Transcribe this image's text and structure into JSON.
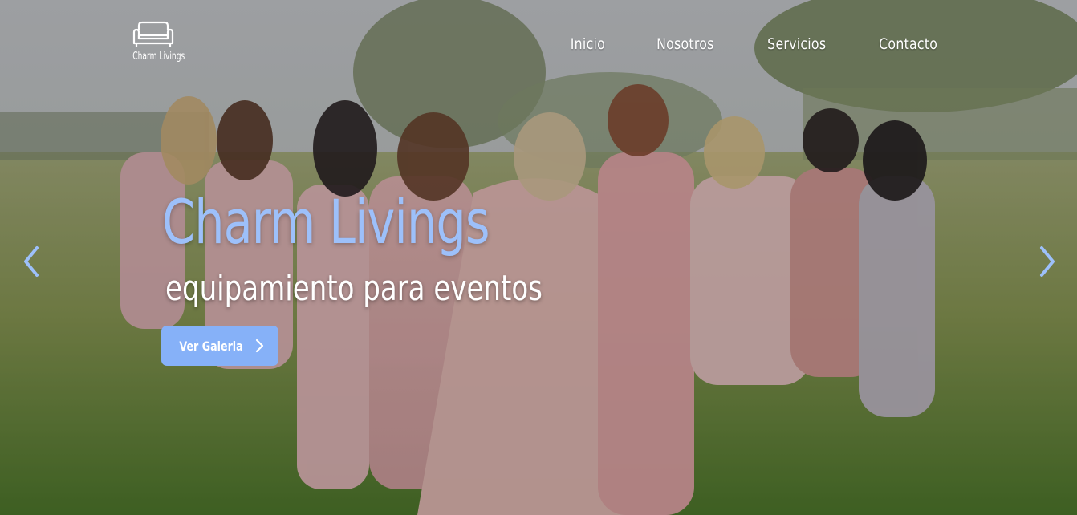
{
  "brand": {
    "logo_text": "Charm Livings"
  },
  "nav": {
    "items": [
      {
        "label": "Inicio"
      },
      {
        "label": "Nosotros"
      },
      {
        "label": "Servicios"
      },
      {
        "label": "Contacto"
      }
    ]
  },
  "hero": {
    "title": "Charm Livings",
    "subtitle": "equipamiento para eventos",
    "cta_label": "Ver Galeria"
  },
  "icons": {
    "logo": "sofa-icon",
    "cta": "chevron-right-icon",
    "prev": "chevron-left-icon",
    "next": "chevron-right-icon"
  },
  "colors": {
    "accent": "#86b1f8",
    "title": "#9dc0fa",
    "text": "#ffffff"
  }
}
